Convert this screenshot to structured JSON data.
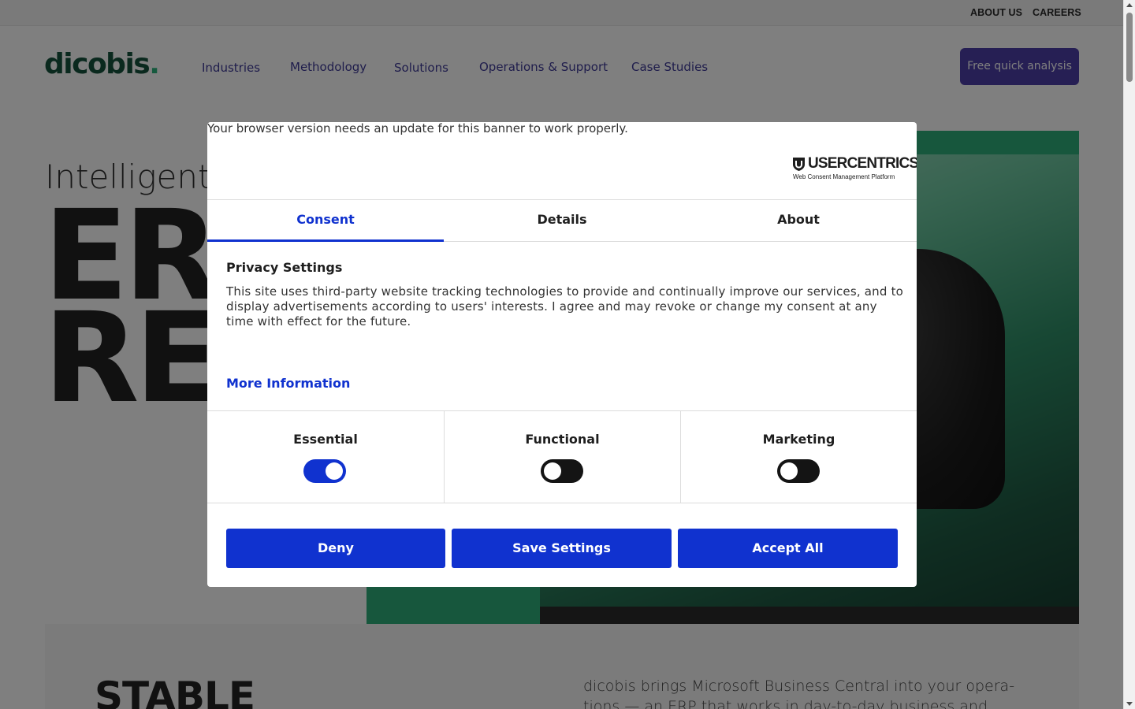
{
  "topbar": {
    "links": [
      "ABOUT US",
      "CAREERS"
    ]
  },
  "header": {
    "logo_text": "dicobis",
    "logo_dot": ".",
    "nav": [
      "Industries",
      "Methodology",
      "Solutions",
      "Operations & Support",
      "Case Studies"
    ],
    "cta_label": "Free quick analysis"
  },
  "hero": {
    "small_text": "Intelligent",
    "big_line1": "ER",
    "big_line2": "RE"
  },
  "lower": {
    "heading": "STABLE",
    "text": "dicobis brings Microsoft Business Central into your opera-tions — an ERP that works in day-to-day business and stays"
  },
  "consent": {
    "browser_note": "Your browser version needs an update for this banner to work properly.",
    "brand": {
      "name": "USERCENTRICS",
      "tagline": "Web Consent Management Platform"
    },
    "tabs": [
      "Consent",
      "Details",
      "About"
    ],
    "active_tab": "Consent",
    "privacy_title": "Privacy Settings",
    "privacy_body": "This site uses third-party website tracking technologies to provide and continually improve our services, and to display advertisements according to users' interests. I agree and may revoke or change my consent at any time with effect for the future.",
    "more_info": "More Information",
    "categories": [
      {
        "label": "Essential",
        "enabled": true
      },
      {
        "label": "Functional",
        "enabled": false
      },
      {
        "label": "Marketing",
        "enabled": false
      }
    ],
    "buttons": {
      "deny": "Deny",
      "save": "Save Settings",
      "accept": "Accept All"
    },
    "accent_color": "#1032cf"
  },
  "colors": {
    "brand_green": "#2eae7a",
    "brand_dark_green": "#14523c",
    "nav_purple": "#3f3a98",
    "cta_purple": "#4d3ea8"
  }
}
